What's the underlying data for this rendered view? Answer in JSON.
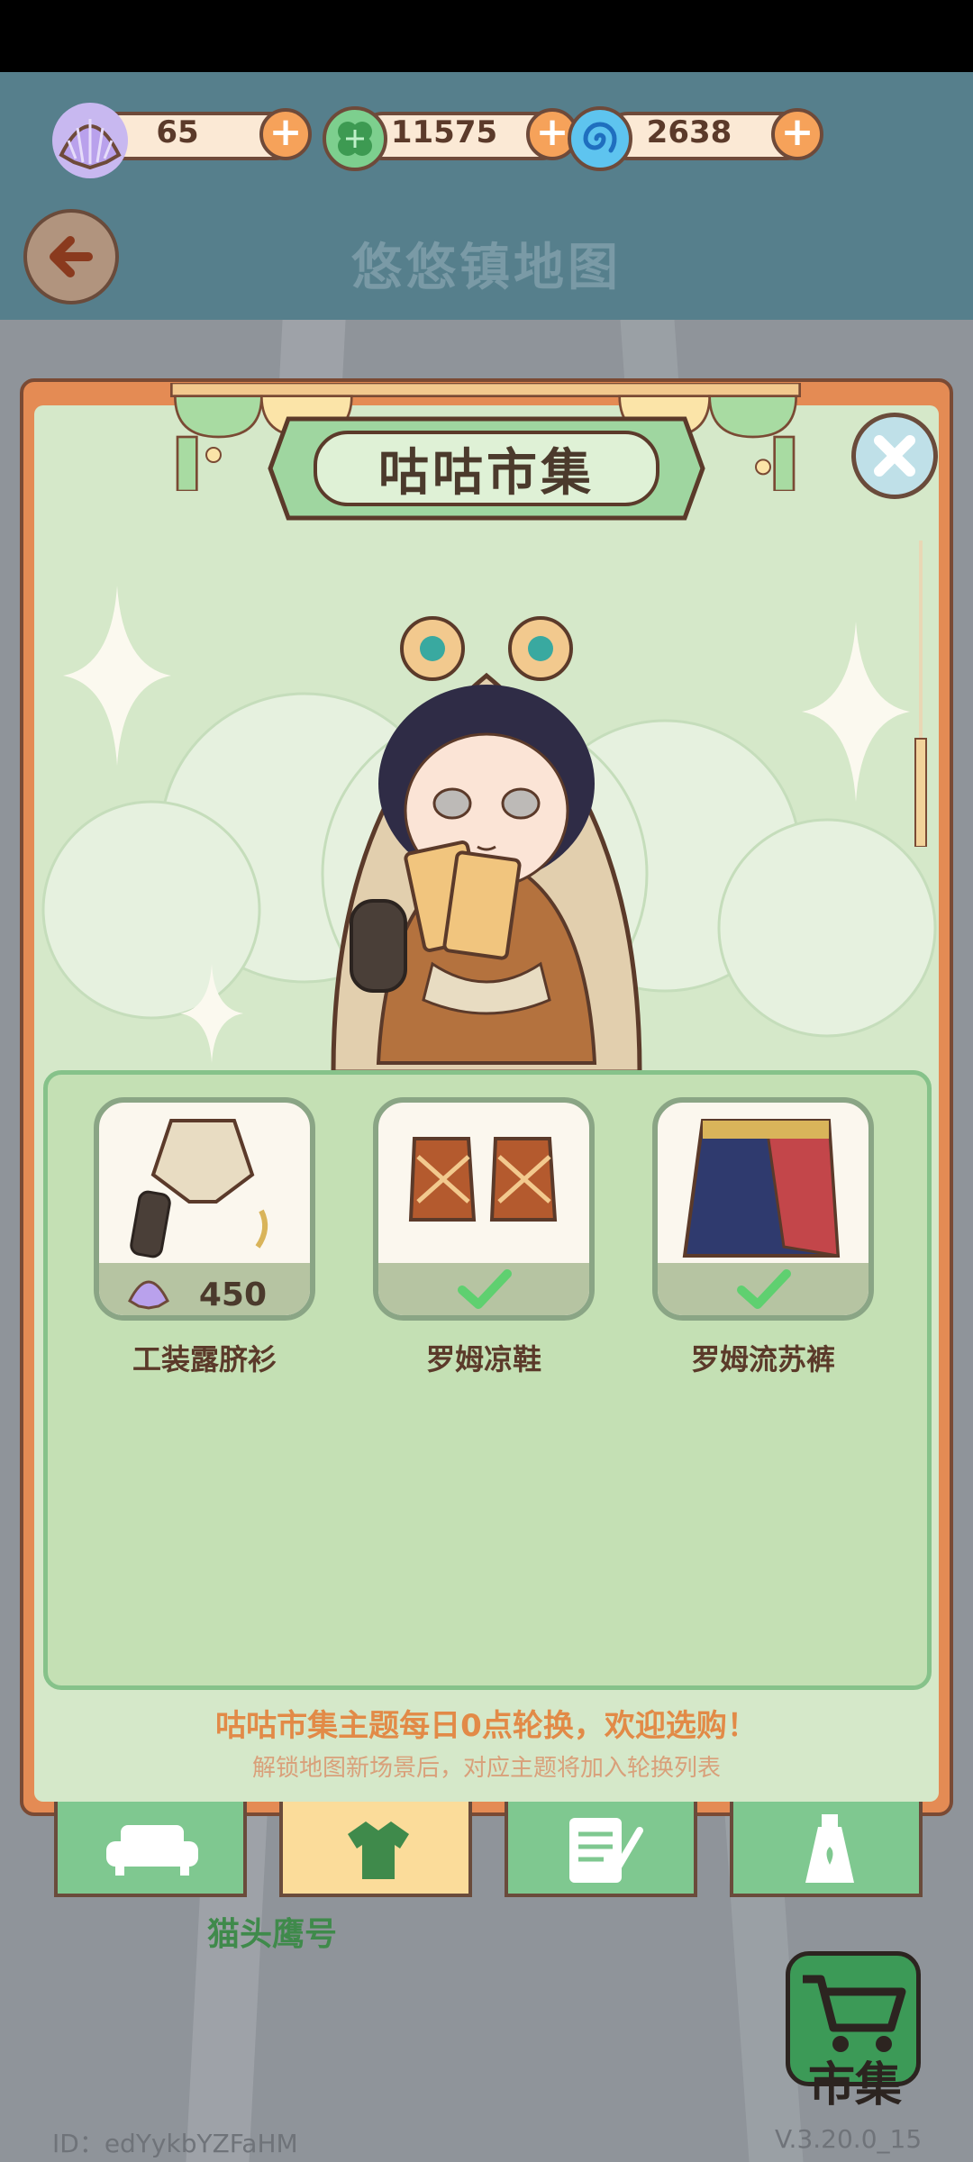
{
  "currencies": [
    {
      "icon": "shell-icon",
      "value": "65"
    },
    {
      "icon": "clover-icon",
      "value": "11575"
    },
    {
      "icon": "swirl-icon",
      "value": "2638"
    }
  ],
  "header": {
    "title": "悠悠镇地图"
  },
  "shop": {
    "title": "咕咕市集",
    "items": [
      {
        "name": "工装露脐衫",
        "price": "450",
        "owned": false
      },
      {
        "name": "罗姆凉鞋",
        "owned": true
      },
      {
        "name": "罗姆流苏裤",
        "owned": true
      }
    ],
    "notice_main": "咕咕市集主题每日0点轮换，欢迎选购！",
    "notice_sub": "解锁地图新场景后，对应主题将加入轮换列表"
  },
  "tabs": [
    {
      "icon": "sofa-icon"
    },
    {
      "icon": "shirt-icon"
    },
    {
      "icon": "notepad-icon"
    },
    {
      "icon": "bottle-icon"
    }
  ],
  "active_tab_label": "猫头鹰号",
  "market_button": {
    "label": "市集"
  },
  "footer": {
    "user_id": "ID：edYykbYZFaHM",
    "version": "V.3.20.0_15"
  },
  "colors": {
    "topbar": "#567f8c",
    "panel": "#d5e8c9",
    "accent_orange": "#e28a47",
    "tab_green": "#7fc890"
  }
}
